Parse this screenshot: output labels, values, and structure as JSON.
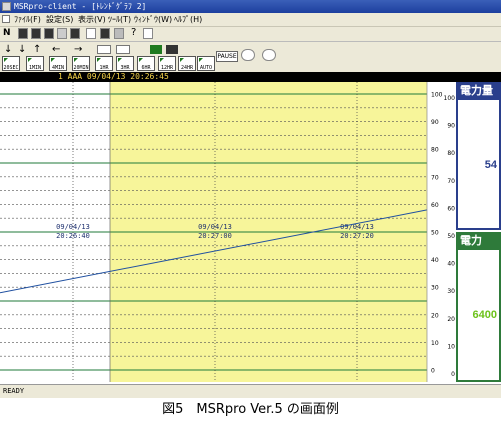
{
  "window": {
    "title": "MSRpro-client - [ﾄﾚﾝﾄﾞｸﾞﾗﾌ 2]"
  },
  "menu": {
    "items": [
      "ﾌｧｲﾙ(F)",
      "設定(S)",
      "表示(V)",
      "ﾂｰﾙ(T)",
      "ｳｨﾝﾄﾞｳ(W)",
      "ﾍﾙﾌﾟ(H)"
    ]
  },
  "toolbar": {
    "range_buttons": [
      "20SEC",
      "1MIN",
      "4MIN",
      "20MIN",
      "1HR",
      "3HR",
      "6HR",
      "12HR",
      "24HR",
      "AUTO"
    ],
    "pause_label": "PAUSE"
  },
  "header": {
    "text": "1  AAA  09/04/13  20:26:45"
  },
  "chart": {
    "time_markers": [
      {
        "date": "09/04/13",
        "time": "20:26:40"
      },
      {
        "date": "09/04/13",
        "time": "20:27:00"
      },
      {
        "date": "09/04/13",
        "time": "20:27:20"
      }
    ],
    "scale1": [
      "100",
      "90",
      "80",
      "70",
      "60",
      "50",
      "40",
      "30",
      "20",
      "10",
      "0"
    ],
    "scale2": [
      "100",
      "90",
      "80",
      "70",
      "60",
      "50",
      "40",
      "30",
      "20",
      "10",
      "0"
    ],
    "highlight_color": "#f7f59a",
    "line_color": "#2050a0",
    "trend_start_value": 28,
    "trend_end_value": 58
  },
  "panels": [
    {
      "title": "電力量",
      "value": "54",
      "color": "#2a3f8c",
      "value_color": "#2a3f8c"
    },
    {
      "title": "電力",
      "value": "6400",
      "color": "#2e7a3a",
      "value_color": "#6cc21a"
    }
  ],
  "status": {
    "text": "READY"
  },
  "caption": {
    "text": "図5　MSRpro Ver.5 の画面例"
  }
}
